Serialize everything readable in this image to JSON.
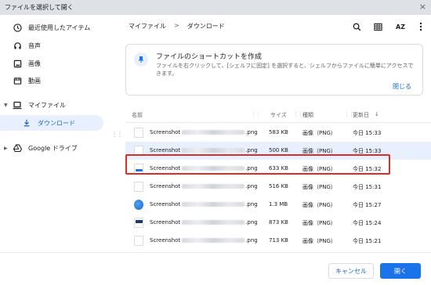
{
  "window": {
    "title": "ファイルを選択して開く",
    "close_glyph": "×"
  },
  "sidebar": {
    "items": [
      {
        "label": "最近使用したアイテム",
        "icon": "clock-icon"
      },
      {
        "label": "音声",
        "icon": "headphones-icon"
      },
      {
        "label": "画像",
        "icon": "image-icon"
      },
      {
        "label": "動画",
        "icon": "video-icon"
      },
      {
        "label": "マイファイル",
        "icon": "laptop-icon"
      },
      {
        "label": "ダウンロード",
        "icon": "download-icon"
      },
      {
        "label": "Google ドライブ",
        "icon": "drive-icon"
      }
    ]
  },
  "breadcrumb": {
    "root": "マイファイル",
    "separator": ">",
    "current": "ダウンロード"
  },
  "toolbar": {
    "search_icon": "search-icon",
    "grid_icon": "grid-view-icon",
    "sort_label": "AZ",
    "menu_icon": "more-vert-icon"
  },
  "banner": {
    "title": "ファイルのショートカットを作成",
    "description": "ファイルを右クリックして、[シェルフに固定] を選択すると、シェルフからファイルに簡単にアクセスできます。",
    "close_label": "閉じる"
  },
  "table": {
    "headers": {
      "name": "名前",
      "size": "サイズ",
      "type": "種類",
      "modified": "更新日"
    },
    "rows": [
      {
        "prefix": "Screenshot",
        "ext": ".png",
        "size": "583 KB",
        "type": "画像（PNG）",
        "date": "今日 15:33",
        "thumb": "plain"
      },
      {
        "prefix": "Screenshot",
        "ext": ".png",
        "size": "500 KB",
        "type": "画像（PNG）",
        "date": "今日 15:33",
        "thumb": "plain"
      },
      {
        "prefix": "Screenshot",
        "ext": ".png",
        "size": "633 KB",
        "type": "画像（PNG）",
        "date": "今日 15:32",
        "thumb": "bar"
      },
      {
        "prefix": "Screenshot",
        "ext": ".png",
        "size": "516 KB",
        "type": "画像（PNG）",
        "date": "今日 15:31",
        "thumb": "plain"
      },
      {
        "prefix": "Screenshot",
        "ext": ".png",
        "size": "1.3 MB",
        "type": "画像（PNG）",
        "date": "今日 15:27",
        "thumb": "blue"
      },
      {
        "prefix": "Screenshot",
        "ext": ".png",
        "size": "873 KB",
        "type": "画像（PNG）",
        "date": "今日 15:24",
        "thumb": "dark"
      },
      {
        "prefix": "Screenshot",
        "ext": ".png",
        "size": "713 KB",
        "type": "画像（PNG）",
        "date": "今日 15:21",
        "thumb": "plain"
      }
    ]
  },
  "footer": {
    "cancel_label": "キャンセル",
    "open_label": "開く"
  }
}
